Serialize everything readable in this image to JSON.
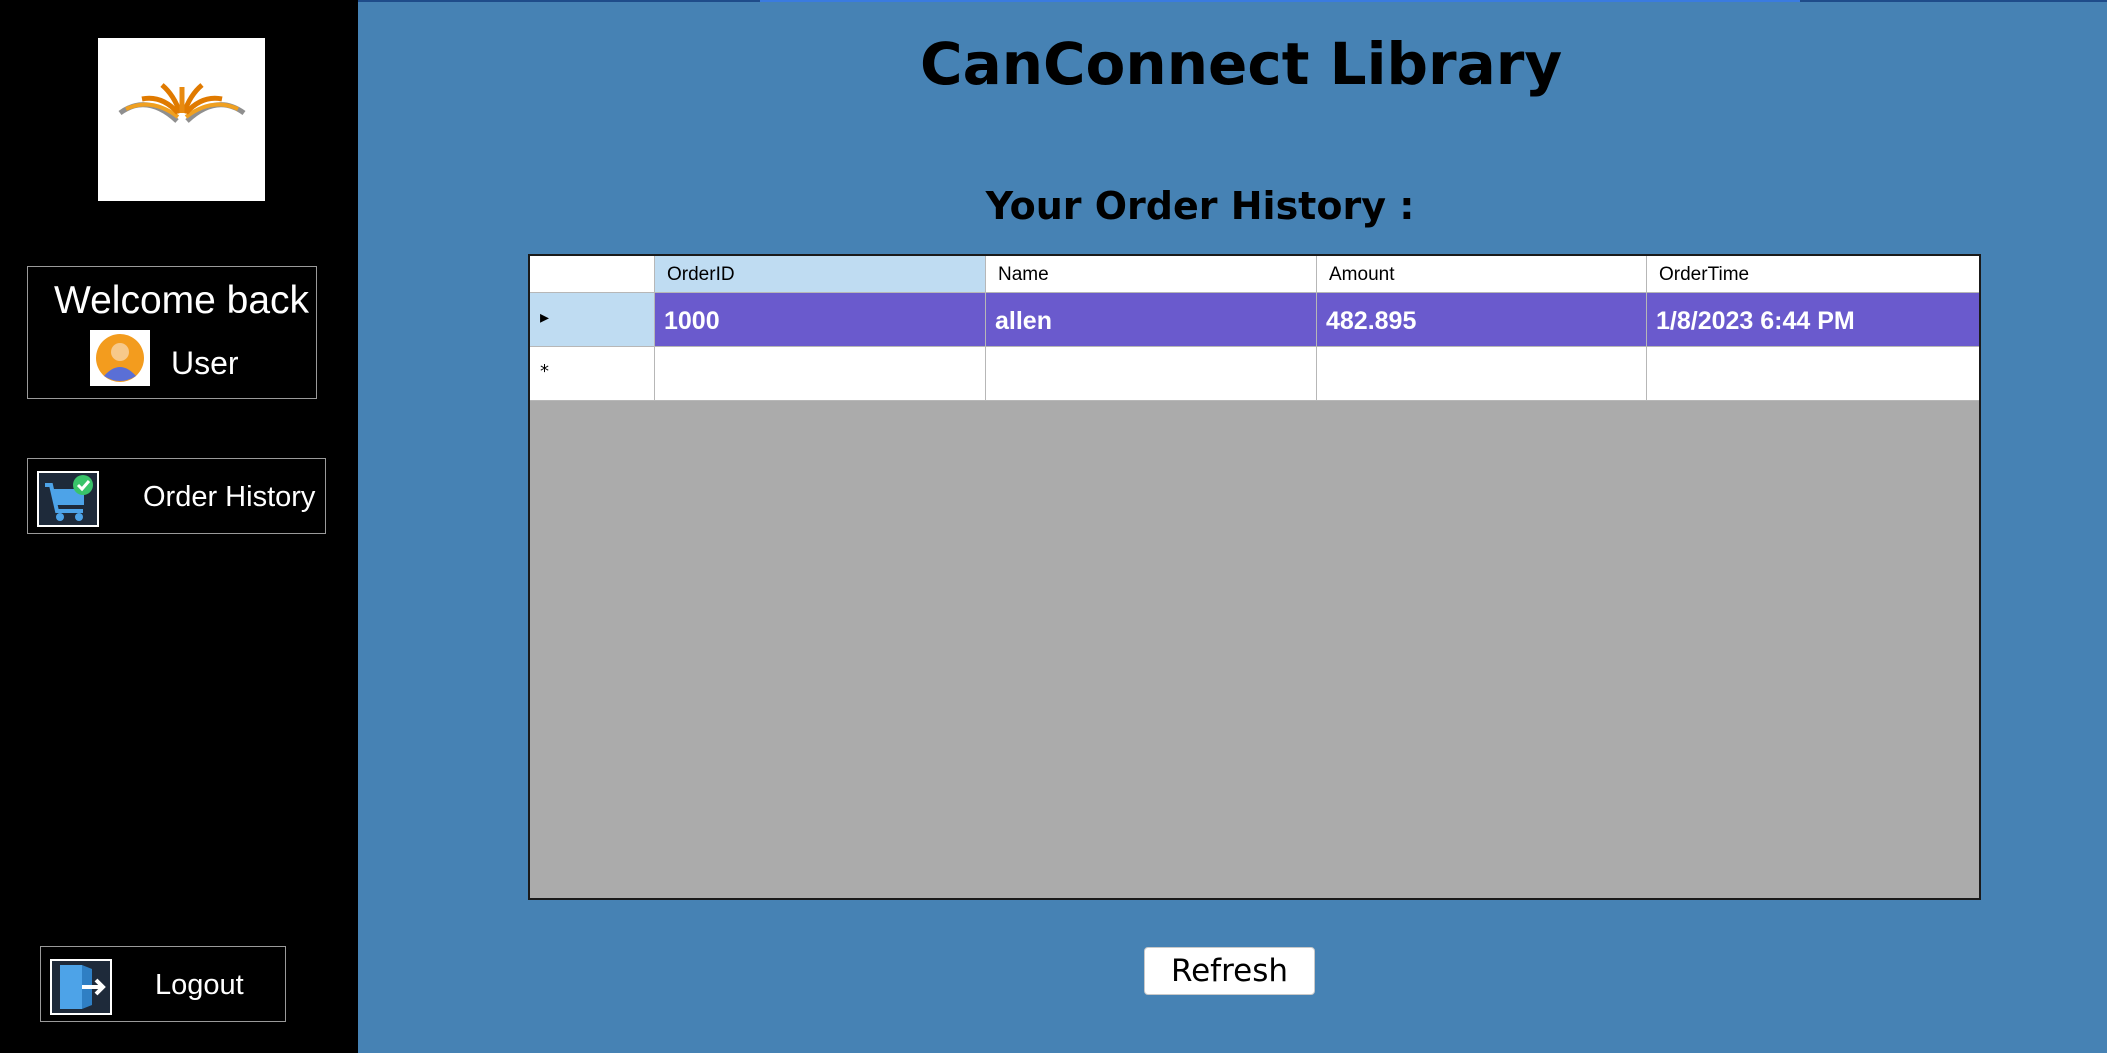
{
  "app": {
    "title": "CanConnect Library"
  },
  "sidebar": {
    "logo_icon": "open-book-logo-icon",
    "welcome": {
      "text": "Welcome back",
      "user": "User",
      "avatar_icon": "user-avatar-icon"
    },
    "nav": [
      {
        "label": "Order History",
        "icon": "cart-check-icon"
      },
      {
        "label": "Logout",
        "icon": "logout-door-icon"
      }
    ]
  },
  "main": {
    "section_title": "Your Order History :",
    "grid": {
      "columns": [
        "OrderID",
        "Name",
        "Amount",
        "OrderTime"
      ],
      "rows": [
        {
          "OrderID": "1000",
          "Name": "allen",
          "Amount": "482.895",
          "OrderTime": "1/8/2023 6:44 PM"
        }
      ],
      "new_row_marker": "*",
      "current_row_marker": "▸"
    },
    "refresh_label": "Refresh"
  },
  "colors": {
    "background": "#4682B4",
    "sidebar": "#000000",
    "selected_row": "#6A5ACD",
    "selected_header": "#BFDCF2",
    "grid_empty": "#ABABAB"
  }
}
